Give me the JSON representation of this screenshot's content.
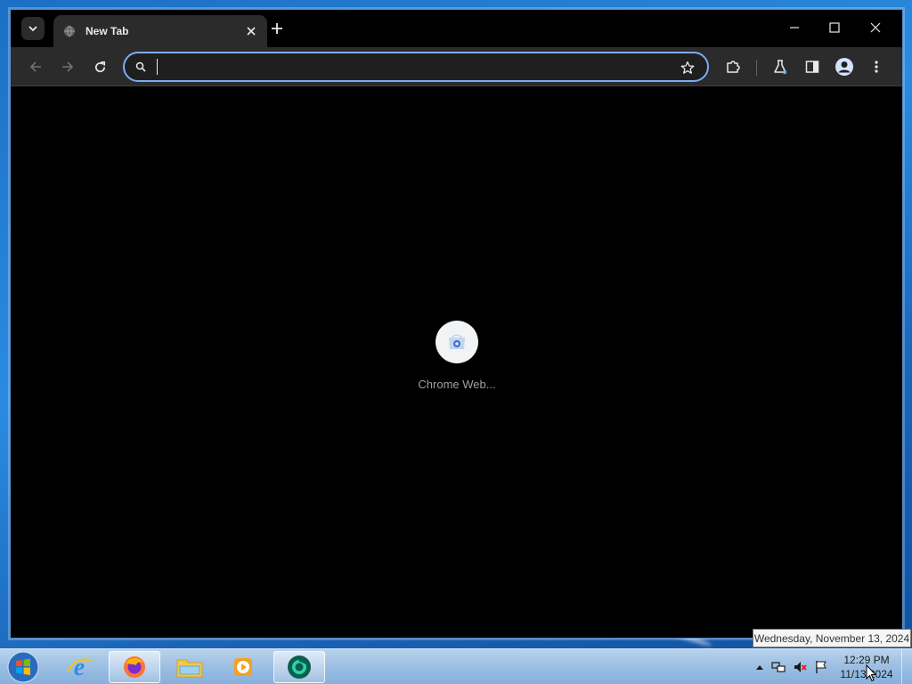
{
  "browser": {
    "tab": {
      "title": "New Tab"
    },
    "omnibox": {
      "value": "",
      "placeholder": ""
    }
  },
  "newtab": {
    "shortcuts": [
      {
        "label": "Chrome Web..."
      }
    ]
  },
  "taskbar": {
    "clock": {
      "time": "12:29 PM",
      "date": "11/13/2024"
    },
    "tooltip": "Wednesday, November 13, 2024",
    "apps": [
      "internet-explorer",
      "firefox",
      "file-explorer",
      "media-player",
      "chrome-beta"
    ]
  },
  "colors": {
    "accent": "#7cacf8",
    "toolbar": "#2b2b2b",
    "page_background": "#000000"
  }
}
